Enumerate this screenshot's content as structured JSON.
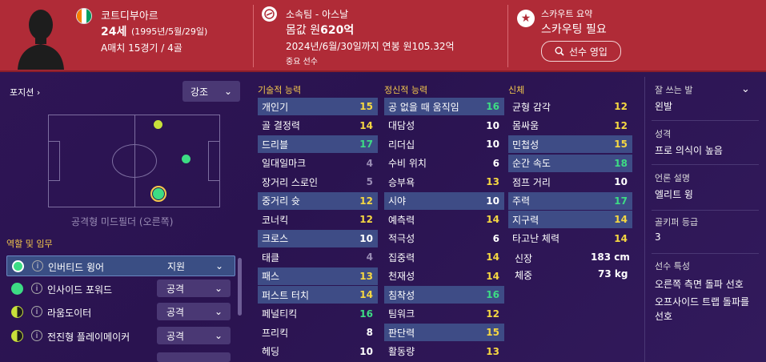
{
  "player": {
    "nationality": "코트디부아르",
    "age": "24세",
    "birth": "(1995년/5월/29일)",
    "intl": "A매치 15경기 / 4골"
  },
  "club": {
    "label": "소속팀 - 아스날",
    "value_prefix": "몸값 원",
    "value_bold": "620억",
    "contract": "2024년/6월/30일까지 연봉 원105.32억",
    "status": "중요 선수"
  },
  "scout": {
    "title": "스카우트 요약",
    "status": "스카우팅 필요",
    "button": "선수 영입"
  },
  "position": {
    "label": "포지션",
    "highlight_dropdown": "강조",
    "caption": "공격형 미드필더 (오른쪽)"
  },
  "roles": {
    "title": "역할 및 임무",
    "items": [
      {
        "name": "인버티드 윙어",
        "duty": "지원",
        "color": "#3ddc84"
      },
      {
        "name": "인사이드 포워드",
        "duty": "공격",
        "color": "#3ddc84"
      },
      {
        "name": "라움도이터",
        "duty": "공격",
        "color": "#c8e03a"
      },
      {
        "name": "전진형 플레이메이커",
        "duty": "공격",
        "color": "#c8e03a"
      }
    ]
  },
  "technical": {
    "title": "기술적 능력",
    "items": [
      {
        "name": "개인기",
        "value": "15",
        "hl": true
      },
      {
        "name": "골 결정력",
        "value": "14",
        "hl": false
      },
      {
        "name": "드리블",
        "value": "17",
        "hl": true
      },
      {
        "name": "일대일마크",
        "value": "4",
        "hl": false
      },
      {
        "name": "장거리 스로인",
        "value": "5",
        "hl": false
      },
      {
        "name": "중거리 슛",
        "value": "12",
        "hl": true
      },
      {
        "name": "코너킥",
        "value": "12",
        "hl": false
      },
      {
        "name": "크로스",
        "value": "10",
        "hl": true
      },
      {
        "name": "태클",
        "value": "4",
        "hl": false
      },
      {
        "name": "패스",
        "value": "13",
        "hl": true
      },
      {
        "name": "퍼스트 터치",
        "value": "14",
        "hl": true
      },
      {
        "name": "페널티킥",
        "value": "16",
        "hl": false
      },
      {
        "name": "프리킥",
        "value": "8",
        "hl": false
      },
      {
        "name": "헤딩",
        "value": "10",
        "hl": false
      }
    ]
  },
  "mental": {
    "title": "정신적 능력",
    "items": [
      {
        "name": "공 없을 때 움직임",
        "value": "16",
        "hl": true
      },
      {
        "name": "대담성",
        "value": "10",
        "hl": false
      },
      {
        "name": "리더십",
        "value": "10",
        "hl": false
      },
      {
        "name": "수비 위치",
        "value": "6",
        "hl": false
      },
      {
        "name": "승부욕",
        "value": "13",
        "hl": false
      },
      {
        "name": "시야",
        "value": "10",
        "hl": true
      },
      {
        "name": "예측력",
        "value": "14",
        "hl": false
      },
      {
        "name": "적극성",
        "value": "6",
        "hl": false
      },
      {
        "name": "집중력",
        "value": "14",
        "hl": false
      },
      {
        "name": "천재성",
        "value": "14",
        "hl": false
      },
      {
        "name": "침착성",
        "value": "16",
        "hl": true
      },
      {
        "name": "팀워크",
        "value": "12",
        "hl": false
      },
      {
        "name": "판단력",
        "value": "15",
        "hl": true
      },
      {
        "name": "활동량",
        "value": "13",
        "hl": false
      }
    ]
  },
  "physical": {
    "title": "신체",
    "items": [
      {
        "name": "균형 감각",
        "value": "12",
        "hl": false
      },
      {
        "name": "몸싸움",
        "value": "12",
        "hl": false
      },
      {
        "name": "민첩성",
        "value": "15",
        "hl": true
      },
      {
        "name": "순간 속도",
        "value": "18",
        "hl": true
      },
      {
        "name": "점프 거리",
        "value": "10",
        "hl": false
      },
      {
        "name": "주력",
        "value": "17",
        "hl": true
      },
      {
        "name": "지구력",
        "value": "14",
        "hl": true
      },
      {
        "name": "타고난 체력",
        "value": "14",
        "hl": false
      }
    ],
    "height_label": "신장",
    "height": "183 cm",
    "weight_label": "체중",
    "weight": "73 kg"
  },
  "info": {
    "foot_label": "잘 쓰는 발",
    "foot": "왼발",
    "personality_label": "성격",
    "personality": "프로 의식이 높음",
    "media_label": "언론 설명",
    "media": "엘리트 윙",
    "gk_label": "골키퍼 등급",
    "gk": "3",
    "traits_label": "선수 특성",
    "trait1": "오른쪽 측면 돌파 선호",
    "trait2": "오프사이드 트랩 돌파를",
    "trait3": "선호"
  },
  "colors": {
    "yellow": "#f5d742",
    "green": "#3ddc84",
    "white": "#ffffff",
    "grey": "#9a8db5",
    "header": "#b02b37"
  }
}
